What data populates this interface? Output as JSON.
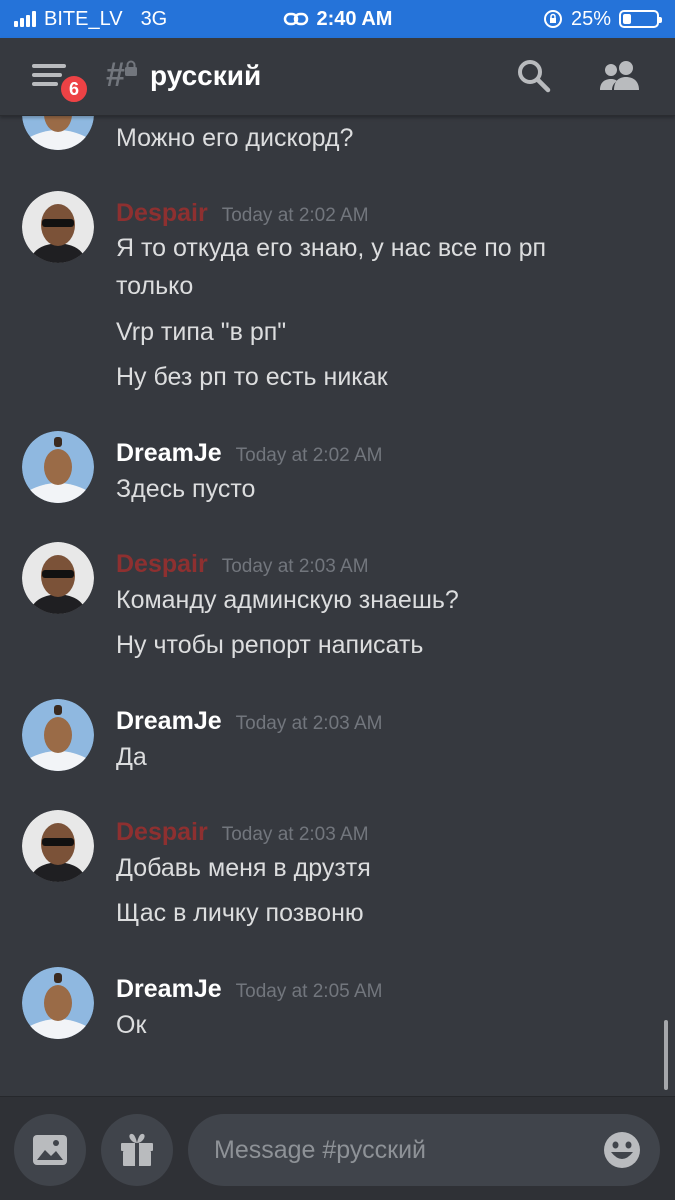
{
  "status_bar": {
    "carrier": "BITE_LV",
    "network": "3G",
    "time": "2:40 AM",
    "battery_percent": "25%",
    "battery_level": 0.25
  },
  "header": {
    "notification_count": "6",
    "channel_name": "русский"
  },
  "colors": {
    "despair_name": "#8e3030",
    "dreamje_name": "#ffffff",
    "badge": "#ed4245",
    "status_bar": "#2573d9"
  },
  "messages": [
    {
      "lines": [
        "Можно его дискорд?"
      ]
    },
    {
      "author": "Despair",
      "timestamp": "Today at 2:02 AM",
      "lines": [
        "Я то откуда его знаю, у нас все по рп",
        "только",
        "Vrp типа \"в рп\"",
        "Ну без рп то есть никак"
      ]
    },
    {
      "author": "DreamJe",
      "timestamp": "Today at 2:02 AM",
      "lines": [
        "Здесь пусто"
      ]
    },
    {
      "author": "Despair",
      "timestamp": "Today at 2:03 AM",
      "lines": [
        "Команду админскую знаешь?",
        "Ну чтобы репорт написать"
      ]
    },
    {
      "author": "DreamJe",
      "timestamp": "Today at 2:03 AM",
      "lines": [
        "Да"
      ]
    },
    {
      "author": "Despair",
      "timestamp": "Today at 2:03 AM",
      "lines": [
        "Добавь меня в друзтя",
        "Щас в личку позвоню"
      ]
    },
    {
      "author": "DreamJe",
      "timestamp": "Today at 2:05 AM",
      "lines": [
        "Ок"
      ]
    }
  ],
  "input": {
    "placeholder": "Message #русский",
    "value": ""
  }
}
